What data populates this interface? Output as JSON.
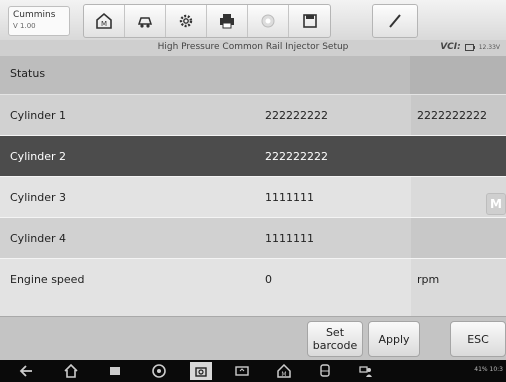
{
  "app": {
    "name": "Cummins",
    "version": "V 1.00"
  },
  "toolbar": {
    "buttons": [
      "home-icon",
      "vehicle-icon",
      "settings-icon",
      "print-icon",
      "help-icon",
      "save-icon",
      "edit-icon"
    ]
  },
  "page_title": "High Pressure Common Rail Injector Setup",
  "vci": {
    "label": "VCI:",
    "voltage": "12.33V"
  },
  "table": {
    "header": "Status",
    "rows": [
      {
        "name": "Cylinder 1",
        "value": "222222222",
        "extra": "2222222222"
      },
      {
        "name": "Cylinder 2",
        "value": "222222222",
        "extra": ""
      },
      {
        "name": "Cylinder 3",
        "value": "1111111",
        "extra": ""
      },
      {
        "name": "Cylinder 4",
        "value": "1111111",
        "extra": ""
      },
      {
        "name": "Engine speed",
        "value": "0",
        "extra": "rpm"
      }
    ]
  },
  "side_tab": "M",
  "footer": {
    "set_barcode": "Set barcode",
    "apply": "Apply",
    "esc": "ESC"
  },
  "navbar": {
    "status_text": "41% 10:3"
  },
  "colors": {
    "selected_row": "#4c4c4c",
    "header_bg": "#bdbdbd"
  }
}
